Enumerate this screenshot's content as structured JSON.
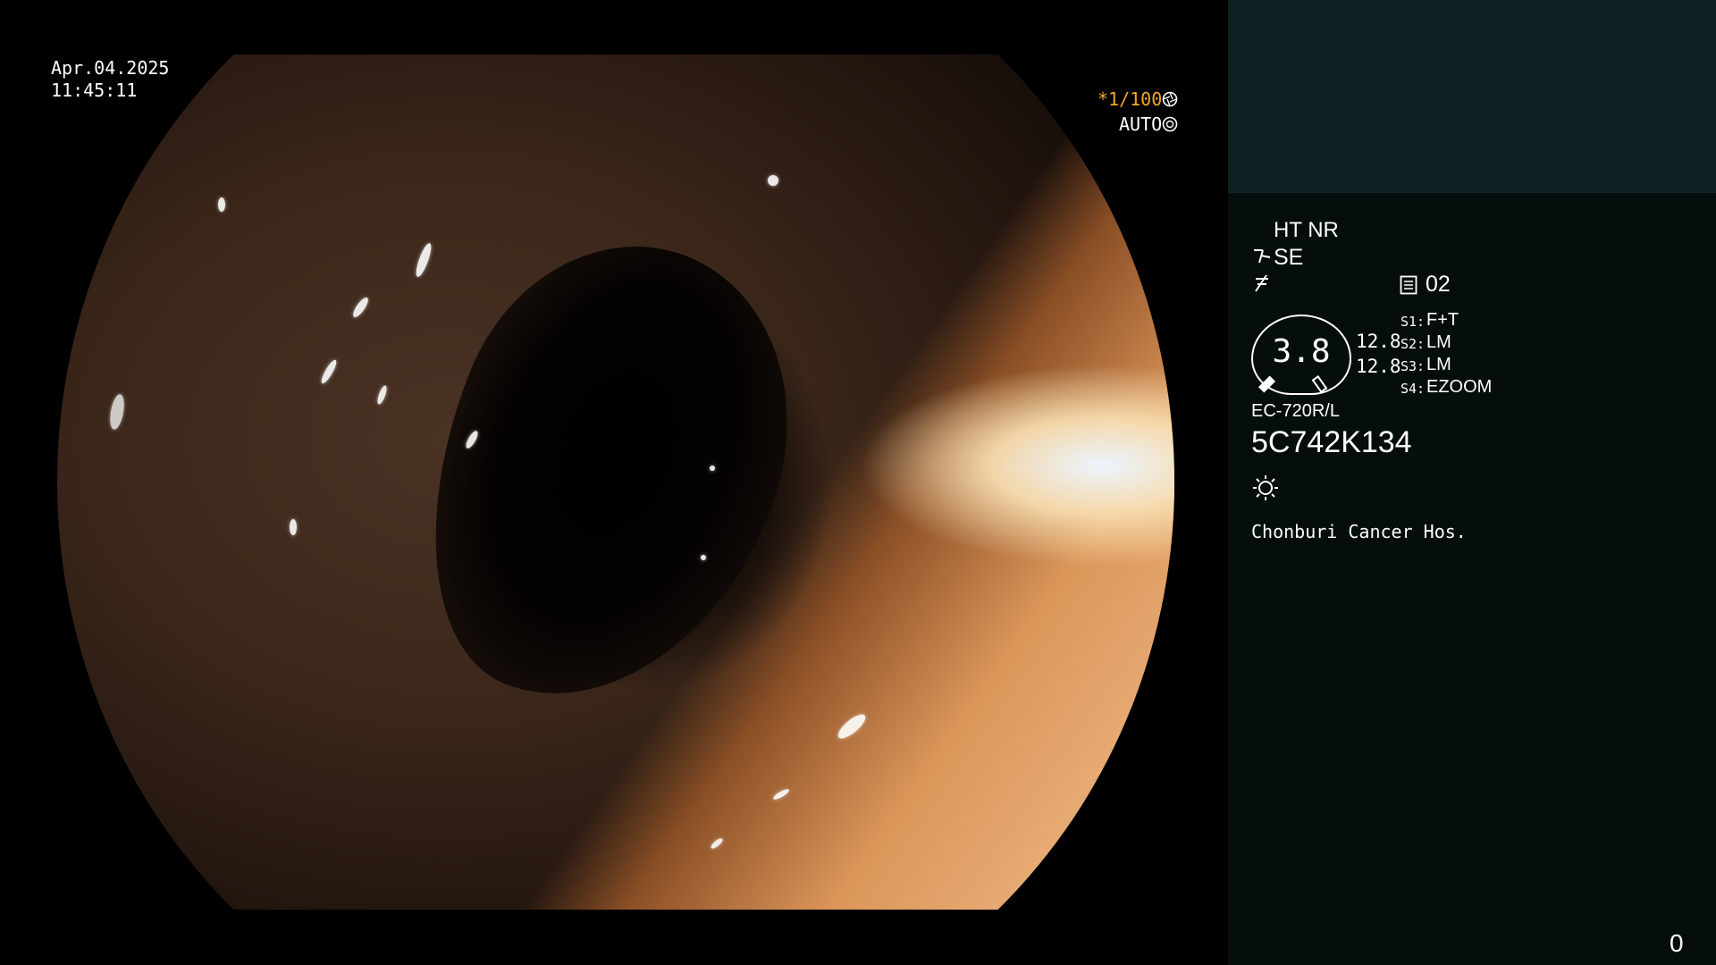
{
  "overlay": {
    "date": "Apr.04.2025",
    "time": "11:45:11",
    "shutter": "*1/100",
    "shutter_icon": "aperture-icon",
    "auto": "AUTO",
    "auto_icon": "iris-icon"
  },
  "panel": {
    "modes": "HT NR",
    "se": "SE",
    "se_icon": "scope-tip-icon",
    "curve_icon": "enhance-icon",
    "memory_icon": "memory-card-icon",
    "memory_value": "02",
    "zoom_value": "3.8",
    "left_values": [
      "12.8",
      "12.8"
    ],
    "switches": [
      {
        "key": "S1:",
        "value": "F+T"
      },
      {
        "key": "S2:",
        "value": "LM"
      },
      {
        "key": "S3:",
        "value": "LM"
      },
      {
        "key": "S4:",
        "value": "EZOOM"
      }
    ],
    "scope_model": "EC-720R/L",
    "serial": "5C742K134",
    "light_icon": "light-sun-icon",
    "hospital": "Chonburi Cancer Hos.",
    "counter": "0"
  },
  "colors": {
    "accent": "#f5a623",
    "panel_top": "#0e2223",
    "panel": "#050e0c"
  }
}
